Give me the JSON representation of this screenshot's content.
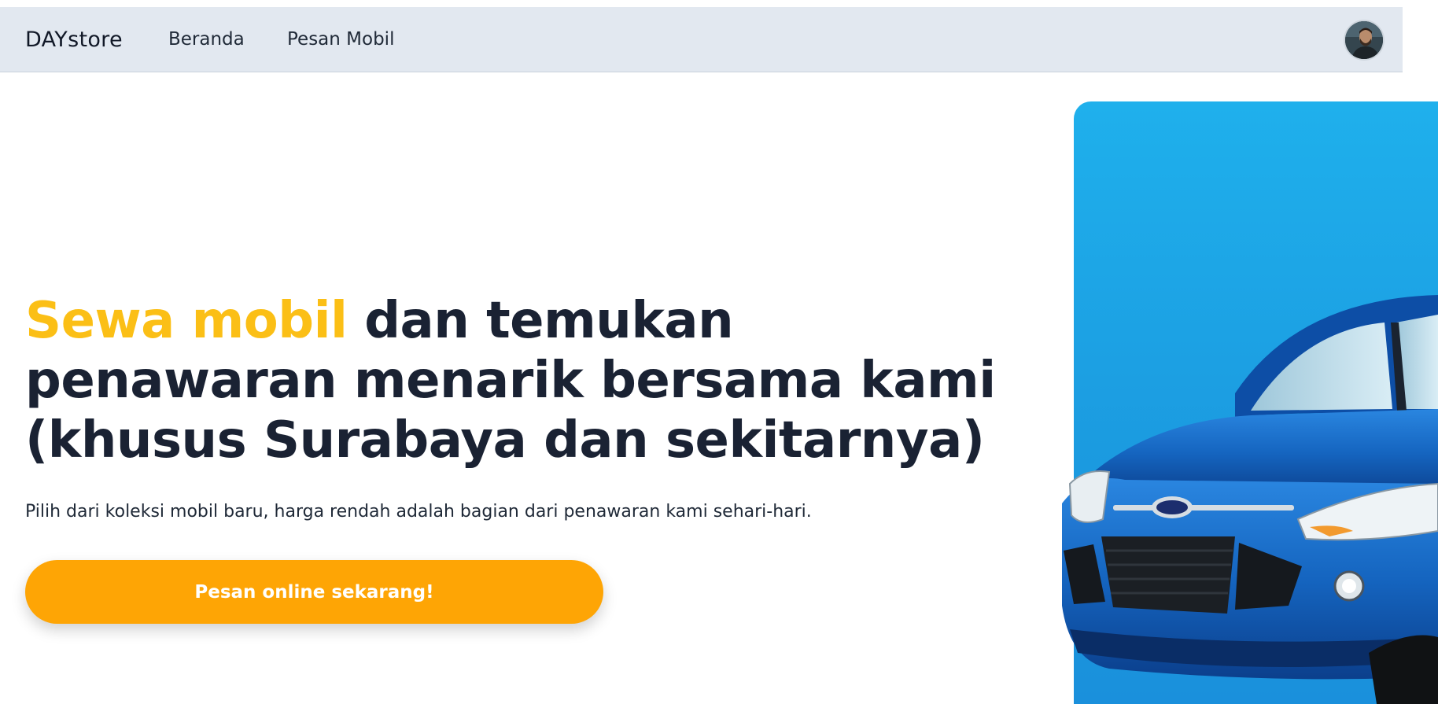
{
  "navbar": {
    "brand": "DAYstore",
    "links": [
      {
        "label": "Beranda"
      },
      {
        "label": "Pesan Mobil"
      }
    ]
  },
  "hero": {
    "title_accent": "Sewa mobil",
    "title_rest": " dan temukan penawaran menarik bersama kami (khusus Surabaya dan sekitarnya)",
    "subtitle": "Pilih dari koleksi mobil baru, harga rendah adalah bagian dari penawaran kami sehari-hari.",
    "cta_label": "Pesan online sekarang!"
  },
  "colors": {
    "navbar_bg": "#e2e8f0",
    "accent_yellow": "#fbbf16",
    "cta_orange": "#fea505",
    "panel_blue": "#1fb0ec",
    "car_blue": "#1565c0",
    "title_text": "#1a2233"
  },
  "icons": {
    "avatar": "user-avatar-photo",
    "hero_image": "blue-car-image"
  }
}
